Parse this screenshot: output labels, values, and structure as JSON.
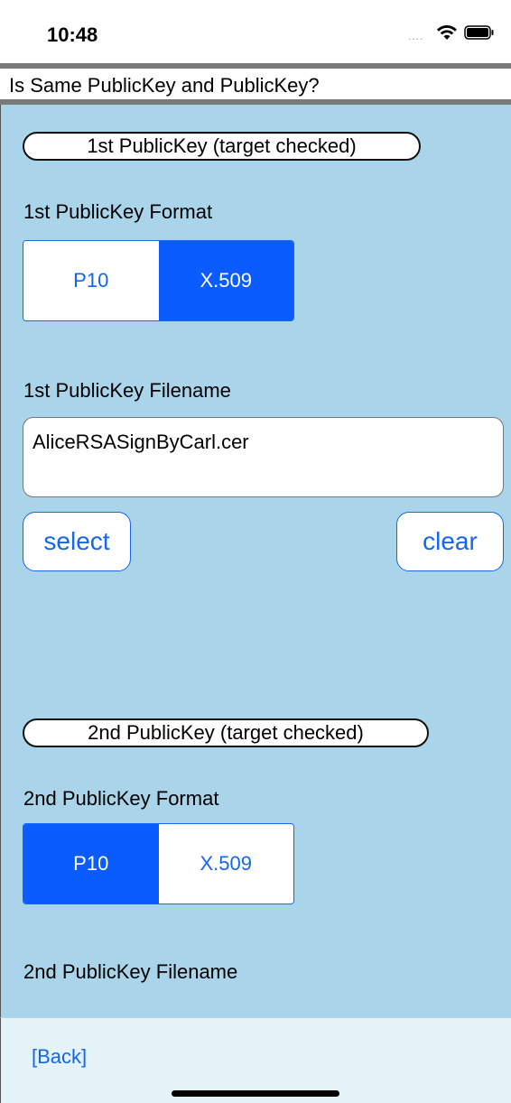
{
  "status_bar": {
    "time": "10:48",
    "signal_dots": "...."
  },
  "title_bar": {
    "title": "Is Same PublicKey and PublicKey?"
  },
  "first_key": {
    "section_label": "1st PublicKey (target checked)",
    "format_label": "1st PublicKey Format",
    "format_options": [
      "P10",
      "X.509"
    ],
    "format_selected": "X.509",
    "filename_label": "1st PublicKey Filename",
    "filename_value": "AliceRSASignByCarl.cer",
    "select_label": "select",
    "clear_label": "clear"
  },
  "second_key": {
    "section_label": "2nd PublicKey (target checked)",
    "format_label": "2nd PublicKey Format",
    "format_options": [
      "P10",
      "X.509"
    ],
    "format_selected": "P10",
    "filename_label": "2nd PublicKey Filename"
  },
  "footer": {
    "back_label": "[Back]"
  },
  "colors": {
    "accent": "#0b5cff",
    "content_bg": "#a9d4ea",
    "footer_bg": "#e3f3f8"
  }
}
